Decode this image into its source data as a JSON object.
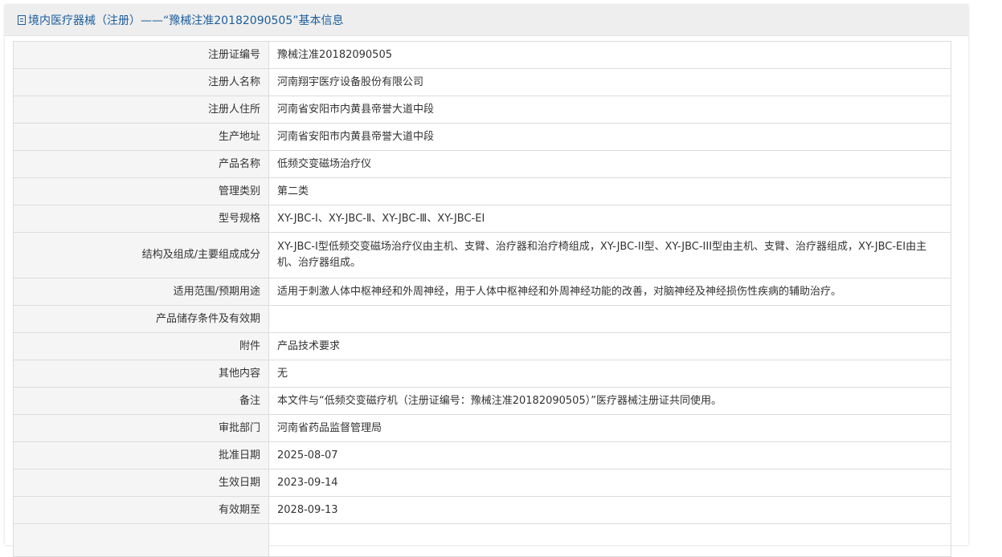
{
  "header": {
    "title": "境内医疗器械（注册）——“豫械注准20182090505”基本信息"
  },
  "rows": [
    {
      "label": "注册证编号",
      "value": "豫械注准20182090505"
    },
    {
      "label": "注册人名称",
      "value": "河南翔宇医疗设备股份有限公司"
    },
    {
      "label": "注册人住所",
      "value": "河南省安阳市内黄县帝誉大道中段"
    },
    {
      "label": "生产地址",
      "value": "河南省安阳市内黄县帝誉大道中段"
    },
    {
      "label": "产品名称",
      "value": "低频交变磁场治疗仪"
    },
    {
      "label": "管理类别",
      "value": "第二类"
    },
    {
      "label": "型号规格",
      "value": "XY-JBC-Ⅰ、XY-JBC-Ⅱ、XY-JBC-Ⅲ、XY-JBC-EI"
    },
    {
      "label": "结构及组成/主要组成成分",
      "value": "XY-JBC-I型低频交变磁场治疗仪由主机、支臂、治疗器和治疗椅组成，XY-JBC-II型、XY-JBC-III型由主机、支臂、治疗器组成，XY-JBC-EI由主机、治疗器组成。"
    },
    {
      "label": "适用范围/预期用途",
      "value": "适用于刺激人体中枢神经和外周神经，用于人体中枢神经和外周神经功能的改善，对脑神经及神经损伤性疾病的辅助治疗。"
    },
    {
      "label": "产品储存条件及有效期",
      "value": ""
    },
    {
      "label": "附件",
      "value": "产品技术要求"
    },
    {
      "label": "其他内容",
      "value": "无"
    },
    {
      "label": "备注",
      "value": "本文件与“低频交变磁疗机（注册证编号：豫械注准20182090505）”医疗器械注册证共同使用。"
    },
    {
      "label": "审批部门",
      "value": "河南省药品监督管理局"
    },
    {
      "label": "批准日期",
      "value": "2025-08-07"
    },
    {
      "label": "生效日期",
      "value": "2023-09-14"
    },
    {
      "label": "有效期至",
      "value": "2028-09-13"
    },
    {
      "label": "",
      "value": ""
    }
  ]
}
